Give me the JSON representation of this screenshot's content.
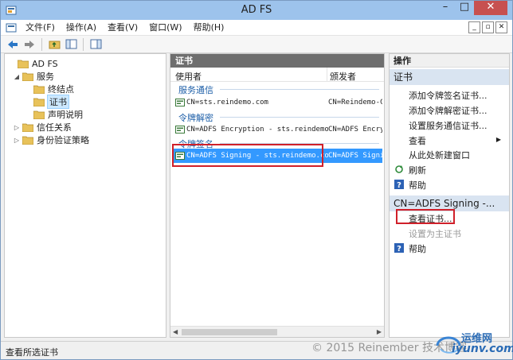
{
  "window": {
    "title": "AD FS",
    "controls": {
      "minimize": "–",
      "maximize": "□",
      "close": "✕"
    }
  },
  "menubar": {
    "items": [
      "文件(F)",
      "操作(A)",
      "查看(V)",
      "窗口(W)",
      "帮助(H)"
    ],
    "mdi": {
      "minimize": "_",
      "restore": "▫",
      "close": "✕"
    }
  },
  "tree": {
    "items": [
      {
        "label": "AD FS",
        "level": 0,
        "expander": ""
      },
      {
        "label": "服务",
        "level": 1,
        "expander": "◢"
      },
      {
        "label": "终结点",
        "level": 2,
        "expander": ""
      },
      {
        "label": "证书",
        "level": 2,
        "expander": "",
        "selected": true
      },
      {
        "label": "声明说明",
        "level": 2,
        "expander": ""
      },
      {
        "label": "信任关系",
        "level": 1,
        "expander": "▷"
      },
      {
        "label": "身份验证策略",
        "level": 1,
        "expander": "▷"
      }
    ]
  },
  "middle": {
    "header": "证书",
    "columns": {
      "subject": "使用者",
      "issuer": "颁发者"
    },
    "groups": [
      {
        "label": "服务通信",
        "rows": [
          {
            "subject": "CN=sts.reindemo.com",
            "issuer": "CN=Reindemo-CA,"
          }
        ]
      },
      {
        "label": "令牌解密",
        "rows": [
          {
            "subject": "CN=ADFS Encryption - sts.reindemo.com",
            "issuer": "CN=ADFS Encrypt"
          }
        ]
      },
      {
        "label": "令牌签名",
        "rows": [
          {
            "subject": "CN=ADFS Signing - sts.reindemo.com",
            "issuer": "CN=ADFS Signin",
            "selected": true
          }
        ]
      }
    ],
    "scroll": {
      "left": "◀",
      "right": "▶"
    }
  },
  "actions": {
    "header": "操作",
    "section1": {
      "title": "证书",
      "items": [
        {
          "label": "添加令牌签名证书...",
          "icon": ""
        },
        {
          "label": "添加令牌解密证书...",
          "icon": ""
        },
        {
          "label": "设置服务通信证书...",
          "icon": ""
        },
        {
          "label": "查看",
          "icon": "",
          "submenu": "▶"
        },
        {
          "label": "从此处新建窗口",
          "icon": ""
        },
        {
          "label": "刷新",
          "icon": "refresh-icon"
        },
        {
          "label": "帮助",
          "icon": "help-icon"
        }
      ]
    },
    "section2": {
      "title": "CN=ADFS Signing -...",
      "items": [
        {
          "label": "查看证书...",
          "icon": "",
          "disabled": false
        },
        {
          "label": "设置为主证书",
          "icon": "",
          "disabled": true
        },
        {
          "label": "帮助",
          "icon": "help-icon",
          "disabled": false
        }
      ]
    }
  },
  "statusbar": {
    "text": "查看所选证书"
  },
  "watermark": {
    "copyright": "© 2015 Reinember 技术博客",
    "site_cn": "运维网",
    "site_url": "iyunv.com"
  },
  "colors": {
    "titlebar": "#9dc3ec",
    "selection": "#3399ff",
    "highlight_box": "#d0202a",
    "group_label": "#1e5fa8"
  }
}
